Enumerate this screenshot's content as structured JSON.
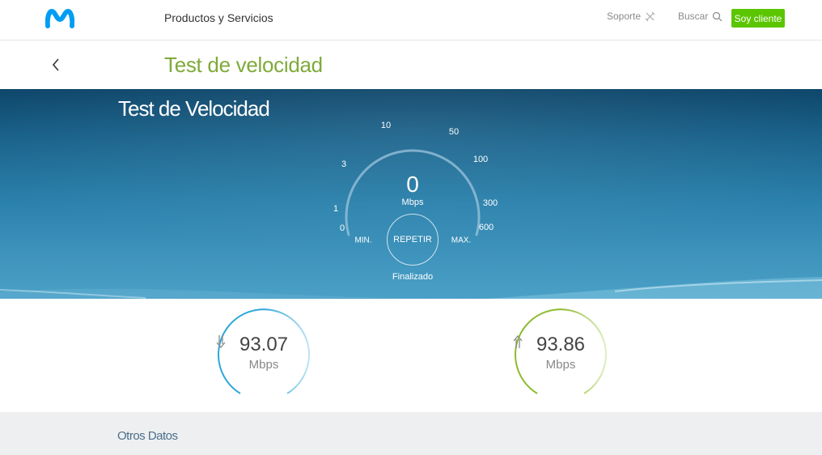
{
  "nav": {
    "products_label": "Productos y Servicios",
    "support_label": "Soporte",
    "search_label": "Buscar",
    "client_button_label": "Soy cliente",
    "logo_icon": "movistar-m-logo",
    "support_icon": "tools-icon",
    "search_icon": "search-icon"
  },
  "subheader": {
    "title": "Test de velocidad",
    "back_icon": "chevron-left-icon"
  },
  "hero": {
    "title": "Test de Velocidad",
    "gauge": {
      "scale_labels": [
        "0",
        "1",
        "3",
        "10",
        "50",
        "100",
        "300",
        "600"
      ],
      "current_value": "0",
      "unit": "Mbps",
      "min_label": "MIN.",
      "max_label": "MAX.",
      "repeat_label": "REPETIR",
      "status": "Finalizado"
    }
  },
  "results": {
    "download": {
      "value": "93.07",
      "unit": "Mbps",
      "icon": "arrow-down-icon",
      "color": "#2ea7d8"
    },
    "upload": {
      "value": "93.86",
      "unit": "Mbps",
      "icon": "arrow-up-icon",
      "color": "#8dbb2e"
    }
  },
  "footer": {
    "other_data_label": "Otros Datos"
  },
  "colors": {
    "brand_blue": "#019df4",
    "title_green": "#7faa3a",
    "button_green": "#5bc500"
  }
}
